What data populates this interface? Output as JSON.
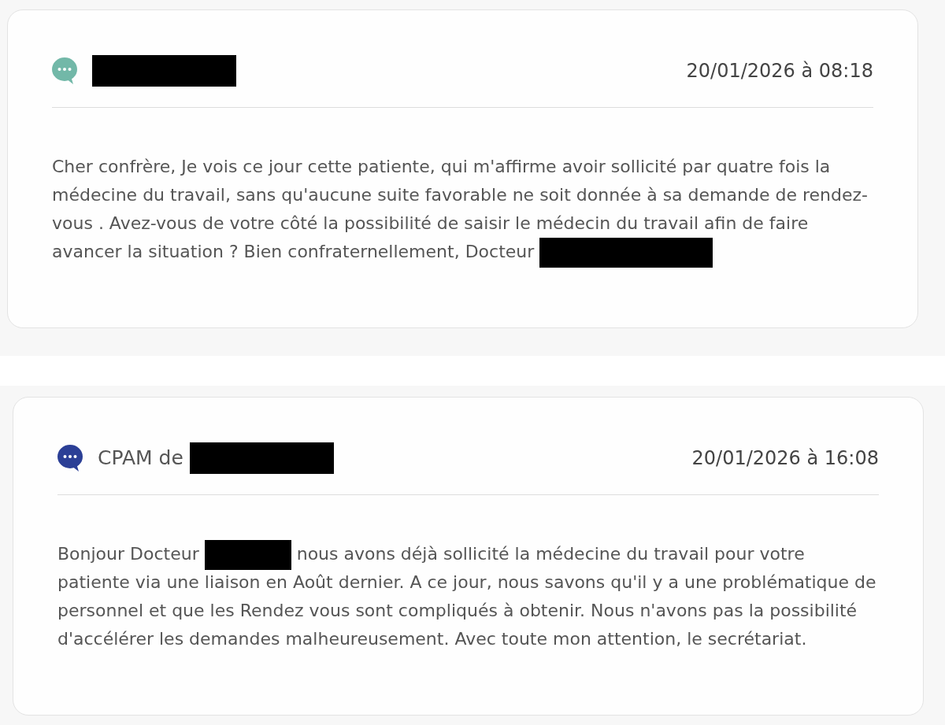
{
  "messages": [
    {
      "color": "#72b8a8",
      "sender": [
        {
          "kind": "redacted"
        }
      ],
      "timestamp": "20/01/2026 à 08:18",
      "body": [
        {
          "kind": "text",
          "text": "Cher confrère, Je vois ce jour cette patiente, qui m'affirme avoir sollicité par quatre fois la médecine du travail, sans qu'aucune suite favorable ne soit donnée à sa demande de rendez-vous . Avez-vous de votre côté la possibilité de saisir le médecin du travail afin de faire avancer la situation ? Bien confraternellement, Docteur"
        },
        {
          "kind": "redacted"
        }
      ]
    },
    {
      "color": "#2b3f96",
      "sender": [
        {
          "kind": "text",
          "text": "CPAM de"
        },
        {
          "kind": "redacted"
        }
      ],
      "timestamp": "20/01/2026 à 16:08",
      "body": [
        {
          "kind": "text",
          "text": "Bonjour Docteur"
        },
        {
          "kind": "redacted"
        },
        {
          "kind": "text",
          "text": "nous avons déjà sollicité la médecine du travail pour votre patiente via une liaison en Août dernier. A ce jour, nous savons qu'il y a une problématique de personnel et que les Rendez vous sont compliqués à obtenir. Nous n'avons pas la possibilité d'accélérer les demandes malheureusement. Avec toute mon attention, le secrétariat."
        }
      ]
    }
  ]
}
